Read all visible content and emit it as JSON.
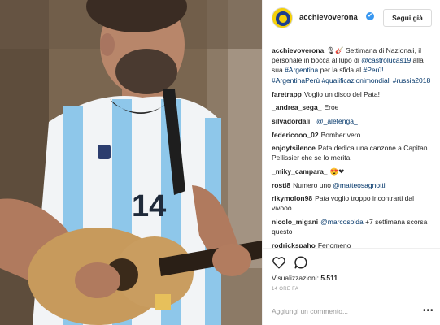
{
  "header": {
    "username": "acchievoverona",
    "verified_mark": "✔",
    "follow_label": "Segui già"
  },
  "caption": {
    "username": "acchievoverona",
    "pre": "🎙🎸 Settimana di Nazionali, il personale in bocca al lupo di ",
    "mention": "@castrolucas19",
    "mid": " alla sua ",
    "tag1": "#Argentina",
    "mid2": " per la sfida al ",
    "tag2": "#Perù!",
    "sp1": " ",
    "tag3": "#ArgentinaPerù",
    "sp2": " ",
    "tag4": "#qualificazionimondiali",
    "sp3": " ",
    "tag5": "#russia2018"
  },
  "comments": [
    {
      "user": "faretrapp",
      "text": "Voglio un disco del Pata!"
    },
    {
      "user": "_andrea_sega_",
      "text": "Eroe"
    },
    {
      "user": "silvadordali_",
      "link": "@_alefenga_",
      "text": ""
    },
    {
      "user": "federicooo_02",
      "text": "Bomber vero"
    },
    {
      "user": "enjoytsilence",
      "text": "Pata dedica una canzone a Capitan Pellissier che se lo merita!"
    },
    {
      "user": "_miky_campara_",
      "text": "😍❤"
    },
    {
      "user": "rosti8",
      "text": "Numero uno ",
      "link": "@matteosagnotti"
    },
    {
      "user": "rikymolon98",
      "text": "Pata voglio troppo incontrarti dal vivooo"
    },
    {
      "user": "nicolo_migani",
      "link": "@marcosolda",
      "text": " +7 settimana scorsa questo"
    },
    {
      "user": "rodrickspaho",
      "text": "Fenomeno"
    }
  ],
  "actions": {
    "like_icon": "heart-icon",
    "comment_icon": "comment-bubble-icon",
    "views_label": "Visualizzazioni: ",
    "views_count": "5.511",
    "time": "14 ORE FA"
  },
  "add_comment": {
    "placeholder": "Aggiungi un commento...",
    "more": "•••"
  },
  "colors": {
    "link": "#003569",
    "verified": "#3897f0",
    "muted": "#999999",
    "border": "#efefef",
    "logo_yellow": "#f5d10a"
  }
}
